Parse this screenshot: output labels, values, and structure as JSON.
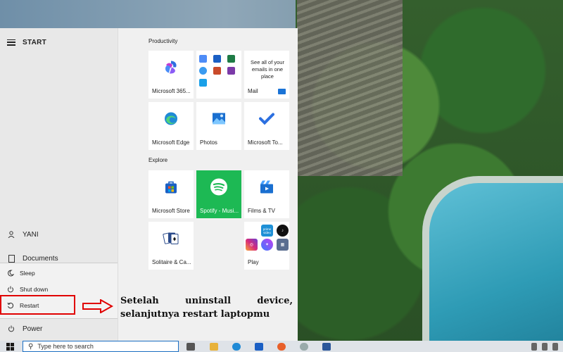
{
  "start_menu": {
    "header_label": "START",
    "user": "YANI",
    "documents": "Documents",
    "power_options": [
      {
        "label": "Sleep",
        "icon": "moon-icon"
      },
      {
        "label": "Shut down",
        "icon": "power-icon"
      },
      {
        "label": "Restart",
        "icon": "restart-icon"
      }
    ],
    "power": "Power"
  },
  "groups": {
    "productivity": "Productivity",
    "explore": "Explore"
  },
  "tiles": {
    "m365": "Microsoft 365...",
    "mail_text": "See all of your emails in one place",
    "mail": "Mail",
    "edge": "Microsoft Edge",
    "photos": "Photos",
    "todo": "Microsoft To...",
    "store": "Microsoft Store",
    "spotify": "Spotify - Musi...",
    "films": "Films & TV",
    "solitaire": "Solitaire & Ca...",
    "play": "Play",
    "prime_label": "prime video"
  },
  "annotation": {
    "line1_words": [
      "Setelah",
      "uninstall",
      "device,"
    ],
    "line2": "selanjutnya restart laptopmu"
  },
  "taskbar": {
    "search_placeholder": "Type here to search"
  },
  "colors": {
    "highlight": "#e00000",
    "spotify": "#1db954",
    "accent": "#1b6ec2"
  }
}
